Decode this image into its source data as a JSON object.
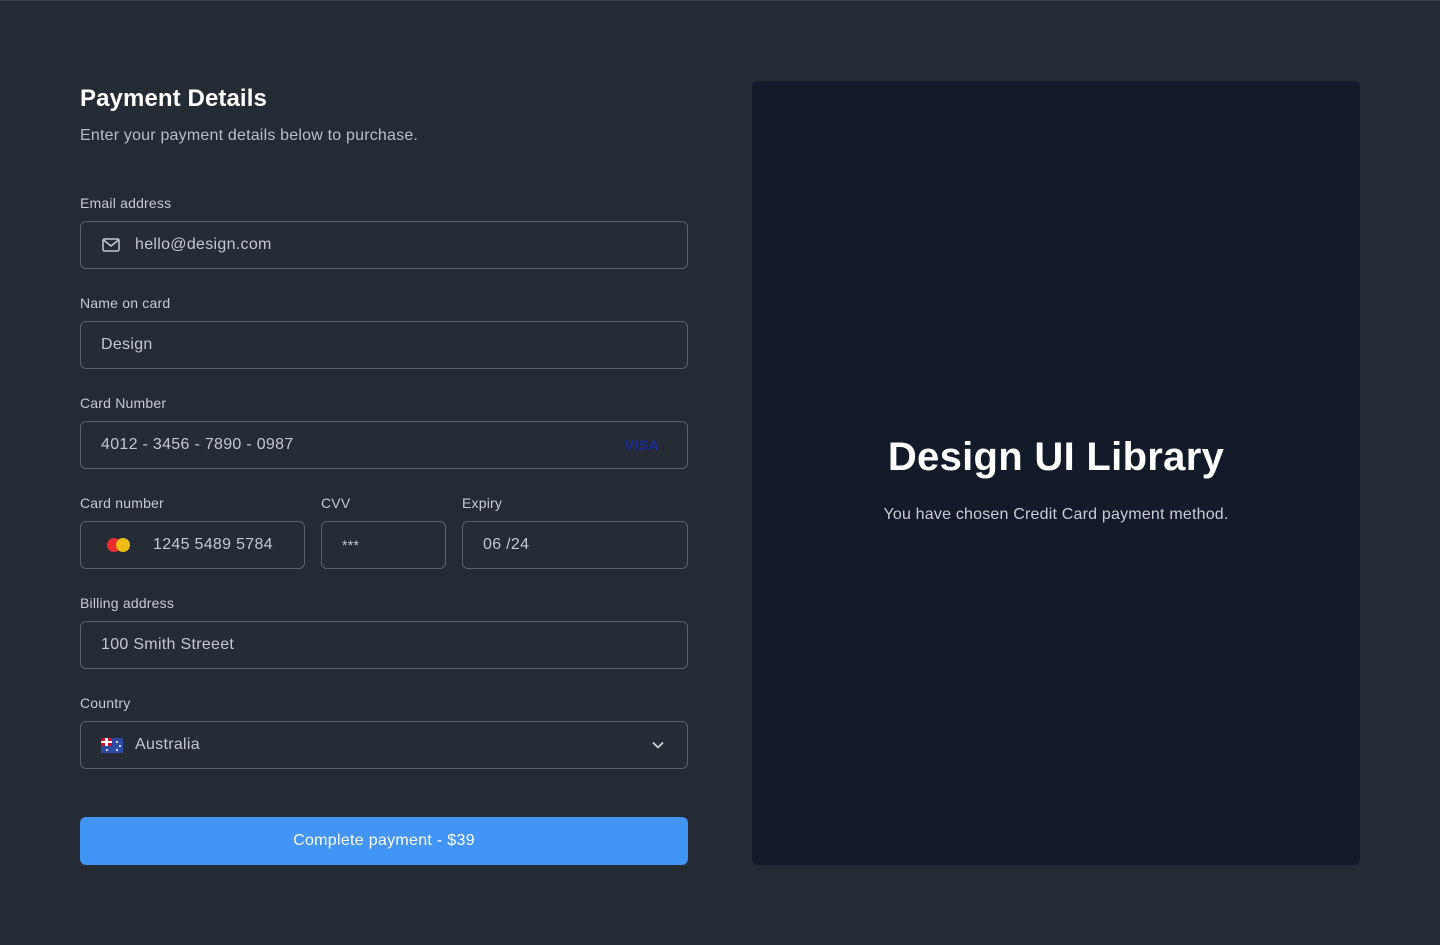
{
  "header": {
    "title": "Payment Details",
    "subtitle": "Enter your payment details below to purchase."
  },
  "form": {
    "email": {
      "label": "Email address",
      "value": "hello@design.com",
      "icon": "mail-icon"
    },
    "name_on_card": {
      "label": "Name on card",
      "value": "Design"
    },
    "card_number": {
      "label": "Card Number",
      "value": "4012 - 3456 - 7890 - 0987",
      "brand": "VISA"
    },
    "card_number_short": {
      "label": "Card number",
      "value": "1245 5489 5784",
      "icon": "mastercard-icon"
    },
    "cvv": {
      "label": "CVV",
      "value": "***"
    },
    "expiry": {
      "label": "Expiry",
      "value": "06 /24"
    },
    "billing_address": {
      "label": "Billing address",
      "value": "100 Smith Streeet"
    },
    "country": {
      "label": "Country",
      "value": "Australia",
      "icon": "australia-flag-icon"
    }
  },
  "submit": {
    "label": "Complete payment - $39"
  },
  "panel": {
    "title": "Design UI Library",
    "text": "You have chosen Credit Card payment method."
  },
  "colors": {
    "background": "#252b34",
    "panel": "#131a29",
    "accent": "#4294f7",
    "field_border": "#5a616c"
  }
}
